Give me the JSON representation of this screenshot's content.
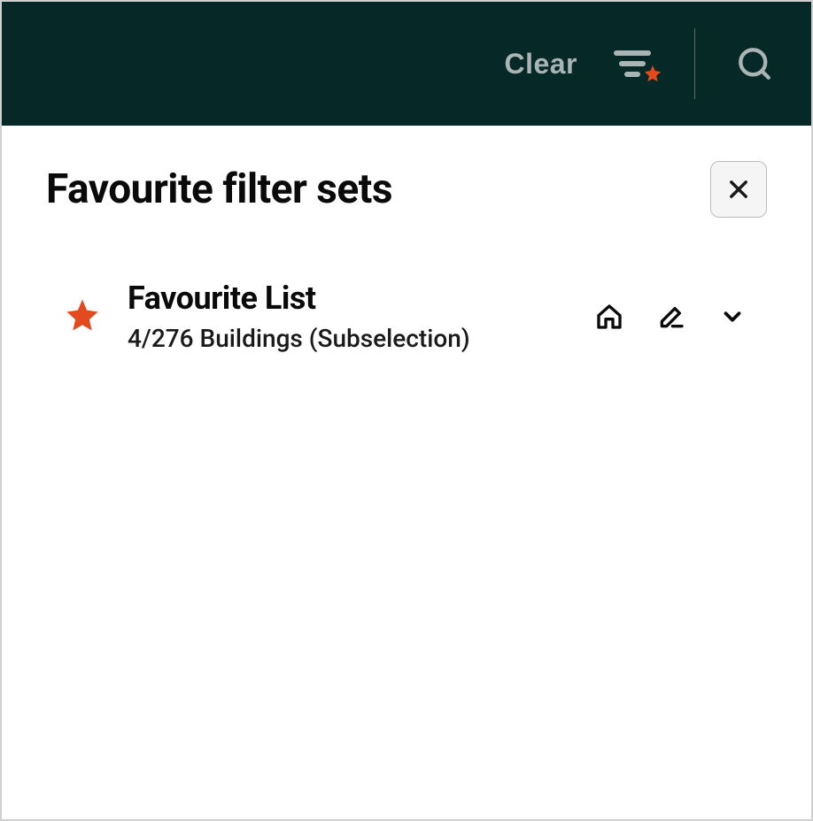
{
  "header": {
    "clear_label": "Clear"
  },
  "page": {
    "title": "Favourite filter sets"
  },
  "filter_sets": [
    {
      "title": "Favourite List",
      "subtitle": "4/276 Buildings (Subselection)"
    }
  ],
  "colors": {
    "header_bg": "#062826",
    "accent": "#e34b1f",
    "muted": "#a8b5b4"
  }
}
